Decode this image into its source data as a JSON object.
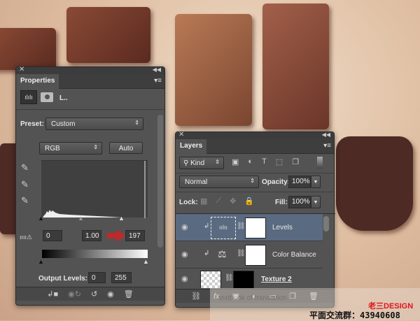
{
  "properties": {
    "title": "Properties",
    "layer_type_label": "L..",
    "preset_label": "Preset:",
    "preset_value": "Custom",
    "channel": "RGB",
    "auto_label": "Auto",
    "input_black": "0",
    "input_gamma": "1.00",
    "input_white": "197",
    "output_label": "Output Levels:",
    "output_black": "0",
    "output_white": "255",
    "icons": [
      "levels-icon",
      "mask-icon",
      "eyedropper-black-icon",
      "eyedropper-gray-icon",
      "eyedropper-white-icon",
      "clip-warning-icon",
      "clip-to-layer-icon",
      "view-previous-icon",
      "reset-icon",
      "visibility-icon",
      "trash-icon"
    ],
    "arrow_color": "#c0282a"
  },
  "layers": {
    "title": "Layers",
    "filter_kind": "Kind",
    "blend_mode": "Normal",
    "opacity_label": "Opacity:",
    "opacity_value": "100%",
    "lock_label": "Lock:",
    "fill_label": "Fill:",
    "fill_value": "100%",
    "items": [
      {
        "name": "Levels",
        "selected": true
      },
      {
        "name": "Color Balance",
        "selected": false
      },
      {
        "name": "Texture 2",
        "selected": false
      }
    ]
  },
  "watermark": {
    "brand": "老三DESIGN",
    "group": "平面交流群：43940608",
    "faint": "textbook of translation",
    "brand_color": "#e0141c"
  }
}
